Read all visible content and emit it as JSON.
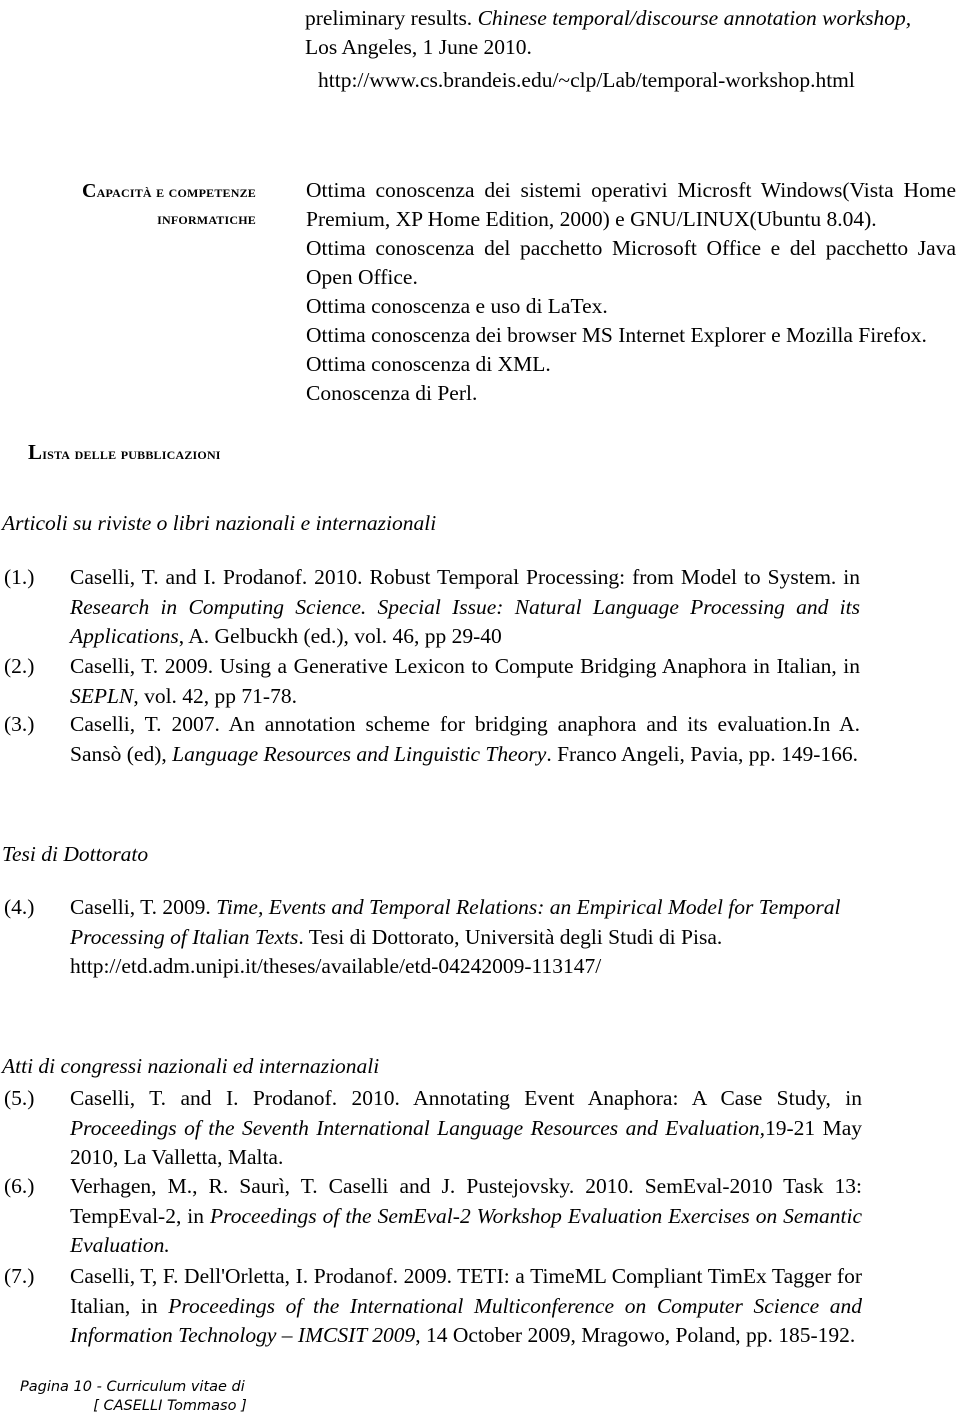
{
  "document": {
    "title": "Curriculum vitae - CASELLI Tommaso - Pagina 10"
  },
  "top_continuation": {
    "line1_plain": "preliminary results. ",
    "line1_italic": "Chinese temporal/discourse annotation workshop,",
    "line2": "Los Angeles, 1 June 2010.",
    "url": "http://www.cs.brandeis.edu/~clp/Lab/temporal-workshop.html"
  },
  "skills_section": {
    "label_line1_first": "C",
    "label_line1_rest": "apacità e competenze",
    "label_line2": "informatiche",
    "items": [
      "Ottima conoscenza dei sistemi operativi Microsft Windows(Vista Home Premium, XP Home Edition, 2000) e GNU/LINUX(Ubuntu 8.04).",
      "Ottima conoscenza del pacchetto Microsoft Office e del pacchetto Java Open Office.",
      "Ottima conoscenza e uso di LaTex.",
      "Ottima conoscenza dei browser MS Internet Explorer e Mozilla Firefox.",
      "Ottima conoscenza di XML.",
      "Conoscenza di Perl."
    ]
  },
  "publications_heading": {
    "first": "L",
    "rest": "ista delle pubblicazioni"
  },
  "groups": {
    "articoli": "Articoli su riviste o libri nazionali e internazionali",
    "tesi": "Tesi di Dottorato",
    "atti": "Atti di congressi nazionali ed internazionali"
  },
  "publications": [
    {
      "number": "(1.)",
      "parts": [
        {
          "text": "Caselli, T. and I. Prodanof. 2010. Robust Temporal Processing: from Model to System. in ",
          "style": "normal"
        },
        {
          "text": "Research in Computing Science. Special Issue: Natural Language Processing and its Applications",
          "style": "italic"
        },
        {
          "text": ", A. Gelbuckh (ed.), vol. 46, pp 29-40",
          "style": "normal"
        }
      ]
    },
    {
      "number": "(2.)",
      "parts": [
        {
          "text": "Caselli, T. 2009. Using a Generative Lexicon to Compute Bridging Anaphora in Italian, in ",
          "style": "normal"
        },
        {
          "text": "SEPLN",
          "style": "italic"
        },
        {
          "text": ", vol. 42, pp 71-78.",
          "style": "normal"
        }
      ]
    },
    {
      "number": "(3.)",
      "parts": [
        {
          "text": "Caselli, T. 2007. An annotation scheme for bridging anaphora and its evaluation.In A. Sansò (ed), ",
          "style": "normal"
        },
        {
          "text": "Language Resources and Linguistic Theory",
          "style": "italic"
        },
        {
          "text": ". Franco Angeli, Pavia, pp. 149-166.",
          "style": "normal"
        }
      ]
    },
    {
      "number": "(4.)",
      "parts": [
        {
          "text": "Caselli, T. 2009. ",
          "style": "normal"
        },
        {
          "text": "Time, Events and Temporal Relations: an Empirical Model for Temporal Processing of Italian Texts",
          "style": "italic"
        },
        {
          "text": ". Tesi di Dottorato, Università degli Studi di Pisa. http://etd.adm.unipi.it/theses/available/etd-04242009-113147/",
          "style": "normal"
        }
      ]
    },
    {
      "number": "(5.)",
      "parts": [
        {
          "text": "Caselli, T. and I. Prodanof. 2010. Annotating Event Anaphora: A Case Study, in ",
          "style": "normal"
        },
        {
          "text": "Proceedings of the Seventh International Language Resources and Evaluation,",
          "style": "italic"
        },
        {
          "text": "19-21 May 2010, La Valletta, Malta.",
          "style": "normal"
        }
      ]
    },
    {
      "number": "(6.)",
      "parts": [
        {
          "text": "Verhagen, M., R. Saurì, T. Caselli and J. Pustejovsky. 2010. SemEval-2010 Task 13: TempEval-2, in ",
          "style": "normal"
        },
        {
          "text": "Proceedings of the SemEval-2 Workshop Evaluation Exercises on Semantic Evaluation.",
          "style": "italic"
        }
      ]
    },
    {
      "number": "(7.)",
      "parts": [
        {
          "text": "Caselli, T, F. Dell'Orletta, I. Prodanof. 2009. TETI: a TimeML Compliant TimEx Tagger for Italian, in ",
          "style": "normal"
        },
        {
          "text": "Proceedings of the International Multiconference on Computer Science and Information Technology – IMCSIT 2009",
          "style": "italic"
        },
        {
          "text": ", 14 October 2009, Mragowo, Poland, pp. 185-192.",
          "style": "normal"
        }
      ]
    }
  ],
  "footer": {
    "line1": "Pagina 10 - Curriculum  vitae  di",
    "line2": "[ CASELLI Tommaso ]"
  }
}
